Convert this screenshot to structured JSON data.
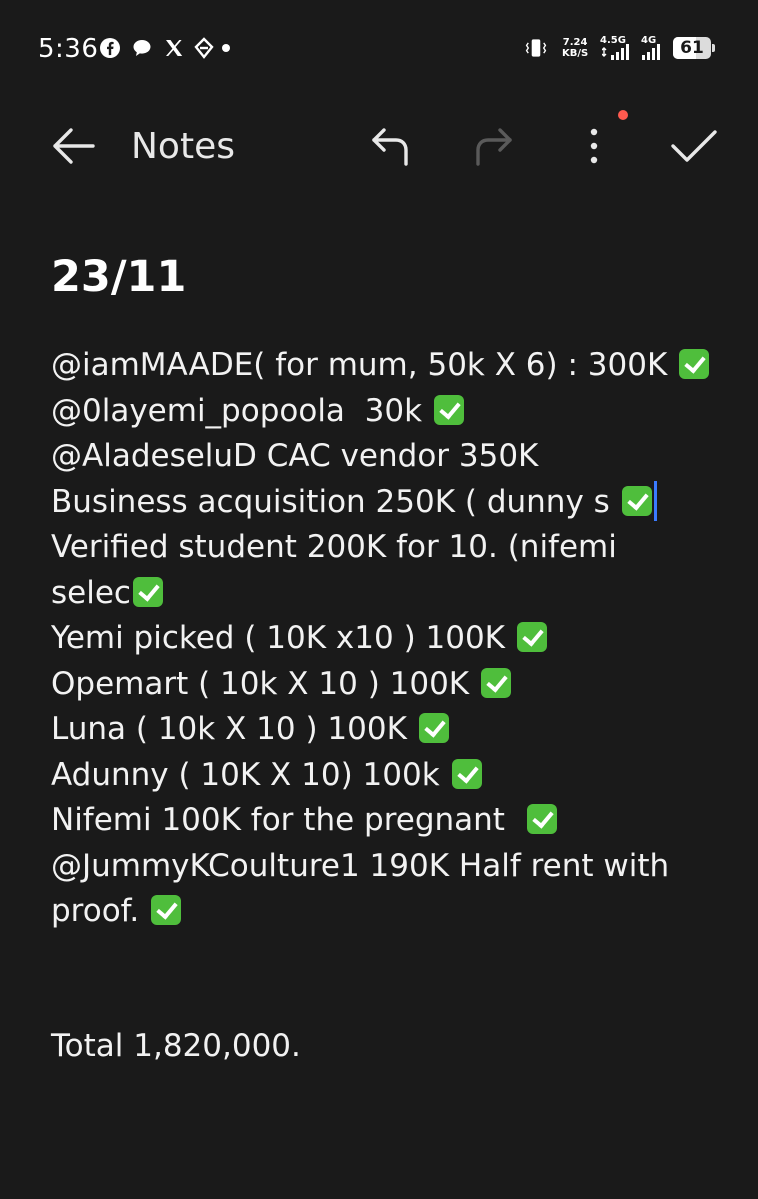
{
  "status_bar": {
    "time": "5:36",
    "net_speed_value": "7.24",
    "net_speed_unit": "KB/S",
    "signal_1_label": "4.5G",
    "signal_2_label": "4G",
    "battery_level": "61"
  },
  "app_bar": {
    "title": "Notes",
    "back_icon": "arrow-left-icon",
    "undo_icon": "undo-icon",
    "redo_icon": "redo-icon",
    "more_icon": "more-vertical-icon",
    "done_icon": "check-icon",
    "notification_color": "#ff5a4f"
  },
  "note": {
    "date": "23/11",
    "lines": [
      "@iamMAADE( for mum, 50k X 6) : 300K",
      "@0layemi_popoola  30k",
      "@AladeseluD CAC vendor 350K",
      "Business acquisition 250K ( dunny s",
      "Verified student 200K for 10. (nifemi",
      "selec",
      "Yemi picked ( 10K x10 ) 100K",
      "Opemart ( 10k X 10 ) 100K",
      "Luna ( 10k X 10 ) 100K",
      "Adunny ( 10K X 10) 100k",
      "Nifemi 100K for the pregnant ",
      "@JummyKCoulture1 190K Half rent with",
      "proof."
    ],
    "total": "Total 1,820,000.",
    "check_color": "#4fbe3c",
    "caret_color": "#3a7bff"
  }
}
